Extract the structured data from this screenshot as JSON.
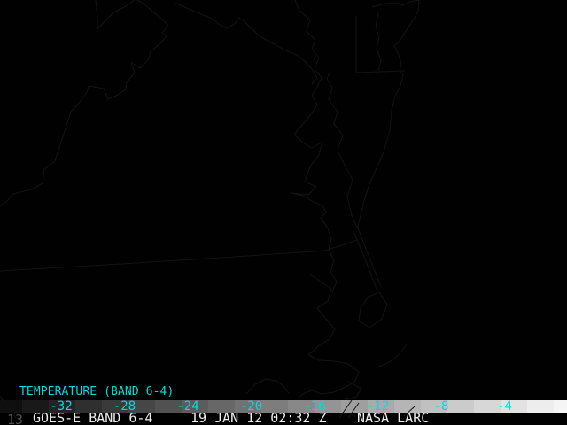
{
  "header": {
    "product_label": "TEMPERATURE (BAND 6-4)"
  },
  "colorbar": {
    "tick_labels": [
      "-32",
      "-28",
      "-24",
      "-20",
      "-16",
      "-12",
      "-8",
      "-4"
    ],
    "tick_values": [
      -32,
      -28,
      -24,
      -20,
      -16,
      -12,
      -8,
      -4
    ],
    "label_color": "#00dcdc",
    "gradient_start": "#0e0e0e",
    "gradient_end": "#f5f5f5"
  },
  "footer": {
    "frame_number": "13",
    "station": "GOES-E BAND 6-4",
    "datetime": "19 JAN 12 02:32 Z",
    "source": "NASA LARC"
  },
  "colors": {
    "accent_cyan": "#00dcdc",
    "footer_text": "#ebebeb",
    "frame_number_gray": "#4d4d4d",
    "map_background": "#010101",
    "coastline": "#131313"
  },
  "map": {
    "region": "Chesapeake Bay / Delmarva coastline overlay",
    "coastline_paths": [
      "M0,306 L120,299 L250,291 L367,283 L403,271",
      "M190,28 L183,37 L188,41 L180,50 L170,58 L167,68 L158,77 L148,70 L152,82 L143,93 L142,101 L133,107 L122,112 L117,100 L100,97 L98,104 L88,118 L80,126 L73,148 L62,182 L50,191 L48,207 L35,214 L15,219 L7,228 L0,233",
      "M108,0 L110,20 L110,33 L127,15 L142,7 L152,0",
      "M155,0 L162,4 L175,15 L190,28",
      "M197,3 L220,13 L237,20 L247,27 L255,32 L265,27 L270,20 L277,25 L283,32 L295,42 L310,50 L322,57 L335,62 L345,70 L352,78 L358,88 L352,95",
      "M333,0 L338,12 L350,22 L346,35 L356,45 L352,55 L360,65 L355,78 L363,88 L358,98 L352,108 L358,118 L352,128 L332,152 L343,162 L352,167 L364,160 L360,175 L350,188 L344,205 L357,211 L348,220 L328,218 L342,221 L354,228 L364,232 L368,240 L362,246 L370,258 L374,270 L371,282 L377,294 L373,307 L380,318 L375,330",
      "M350,310 L362,318 L374,326 L370,340 L358,348 L368,360 L378,372 L372,383 L360,390 L352,398 L347,400",
      "M347,400 L360,407 L378,408 L393,411 L405,420 L400,432 L388,438 L377,443 L363,445 L352,441 L342,445 L337,449",
      "M393,431 L408,439 L402,448 L389,451",
      "M278,445 L288,434 L300,428 L312,430 L320,436 L326,444",
      "M428,330 L437,344 L431,360 L417,370 L405,362 L407,348 L416,335 Z",
      "M459,389 L448,403 L436,411 L424,415",
      "M397,452 L383,472",
      "M405,455 L393,472",
      "M468,459 L456,470",
      "M0,448 L18,472",
      "M397,243 L392,222 L398,203 L389,186 L381,170 L387,153 L377,140 L381,126 L371,113 L375,99 L369,89 L372,82",
      "M397,243 L402,255 L404,257",
      "M402,18 L402,82 L457,80",
      "M427,15 L424,30 L428,42 L425,55 L430,68 L427,80",
      "M420,8 L436,4 L448,3 L455,6 L463,2 L473,0",
      "M473,0 L472,12 L468,20 L460,32 L452,45 L445,52 L450,62 L453,72 L451,80 L455,84 L452,97 L446,108 L442,125 L440,147 L433,172 L424,192 L417,208 L411,226 L407,243 L404,256",
      "M404,258 L417,291 L430,324",
      "M400,263 L413,295 L426,329"
    ]
  }
}
